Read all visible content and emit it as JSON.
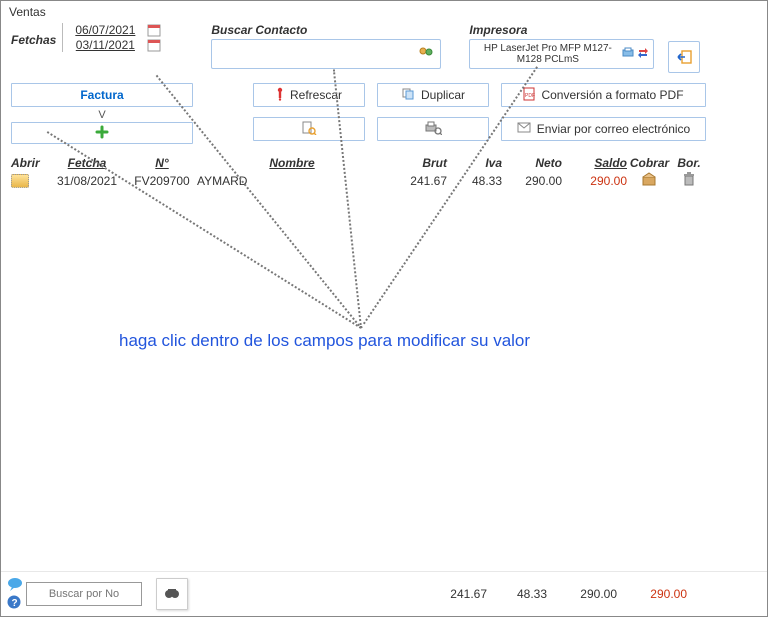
{
  "window": {
    "title": "Ventas"
  },
  "fetchas": {
    "label": "Fetchas",
    "from": "06/07/2021",
    "to": "03/11/2021"
  },
  "contact": {
    "label": "Buscar Contacto",
    "value": ""
  },
  "printer": {
    "label": "Impresora",
    "name": "HP LaserJet Pro MFP M127-M128 PCLmS"
  },
  "buttons": {
    "factura": "Factura",
    "v": "V",
    "refrescar": "Refrescar",
    "duplicar": "Duplicar",
    "pdf": "Conversión a formato PDF",
    "icononly1": "",
    "icononly2": "",
    "email": "Enviar por correo electrónico"
  },
  "grid": {
    "headers": {
      "abrir": "Abrir",
      "fecha": "Fetcha",
      "no": "N°",
      "nombre": "Nombre",
      "brut": "Brut",
      "iva": "Iva",
      "neto": "Neto",
      "saldo": "Saldo",
      "cobrar": "Cobrar",
      "bor": "Bor."
    },
    "rows": [
      {
        "fecha": "31/08/2021",
        "no": "FV209700",
        "nombre": "AYMARD",
        "brut": "241.67",
        "iva": "48.33",
        "neto": "290.00",
        "saldo": "290.00"
      }
    ]
  },
  "annotation": "haga clic dentro de los campos para modificar su valor",
  "status": {
    "search_placeholder": "Buscar por No",
    "tot_brut": "241.67",
    "tot_iva": "48.33",
    "tot_neto": "290.00",
    "tot_saldo": "290.00"
  }
}
